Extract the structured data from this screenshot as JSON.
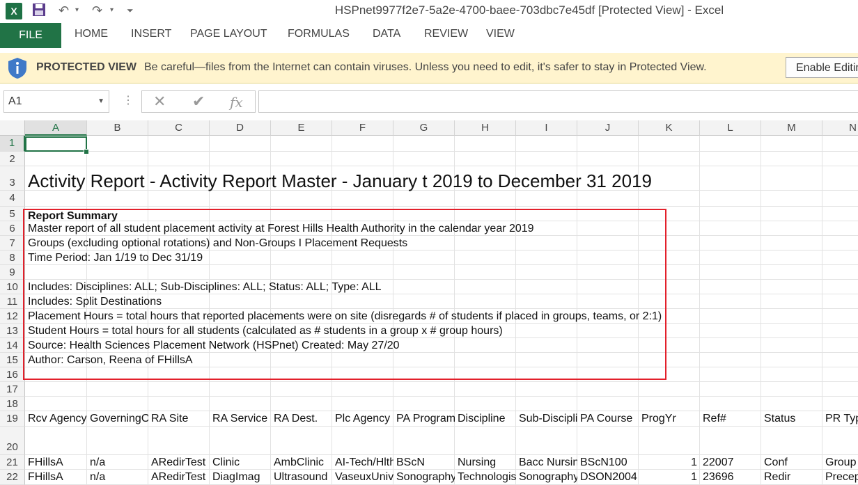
{
  "window": {
    "title": "HSPnet9977f2e7-5a2e-4700-baee-703dbc7e45df  [Protected View] - Excel",
    "app_logo": "X"
  },
  "ribbon": {
    "file_tab": "FILE",
    "tabs": [
      "HOME",
      "INSERT",
      "PAGE LAYOUT",
      "FORMULAS",
      "DATA",
      "REVIEW",
      "VIEW"
    ]
  },
  "protected_view": {
    "title": "PROTECTED VIEW",
    "message": "Be careful—files from the Internet can contain viruses. Unless you need to edit, it's safer to stay in Protected View.",
    "button": "Enable Editing"
  },
  "formula_bar": {
    "name_box": "A1",
    "fx_label": "fx",
    "formula": ""
  },
  "grid": {
    "columns": [
      "A",
      "B",
      "C",
      "D",
      "E",
      "F",
      "G",
      "H",
      "I",
      "J",
      "K",
      "L",
      "M",
      "N"
    ],
    "rows": [
      "1",
      "2",
      "3",
      "4",
      "5",
      "6",
      "7",
      "8",
      "9",
      "10",
      "11",
      "12",
      "13",
      "14",
      "15",
      "16",
      "17",
      "18",
      "19",
      "20",
      "21",
      "22"
    ],
    "title": "Activity Report - Activity Report Master - January t 2019 to December 31 2019",
    "summary": {
      "heading": "Report Summary",
      "lines": [
        "Master report of all student placement activity at Forest Hills Health Authority in the calendar year 2019",
        "Groups (excluding optional rotations) and Non-Groups I Placement Requests",
        "Time Period: Jan 1/19 to Dec 31/19",
        "",
        "Includes: Disciplines: ALL; Sub-Disciplines: ALL;  Status: ALL;  Type: ALL",
        "Includes: Split Destinations",
        "Placement Hours = total hours that reported placements were on site (disregards # of students if placed in groups, teams, or 2:1)",
        "Student Hours = total hours for all students (calculated as # students in a group x # group hours)",
        "Source: Health Sciences Placement Network (HSPnet)    Created: May 27/20",
        "Author: Carson, Reena of FHillsA"
      ]
    },
    "header_row": [
      "Rcv Agency",
      "GoverningO",
      "RA Site",
      "RA Service",
      "RA Dest.",
      "Plc Agency",
      "PA Program",
      "Discipline",
      "Sub-Discipli",
      "PA Course",
      "ProgYr",
      "Ref#",
      "Status",
      "PR Typ"
    ],
    "data_rows": [
      [
        "FHillsA",
        "n/a",
        "ARedirTest",
        "Clinic",
        "AmbClinic",
        "AI-Tech/Hlth",
        "BScN",
        "Nursing",
        "Bacc Nursin",
        "BScN100",
        "1",
        "22007",
        "Conf",
        "Group"
      ],
      [
        "FHillsA",
        "n/a",
        "ARedirTest",
        "DiagImag",
        "Ultrasound",
        "VaseuxUniv",
        "Sonography",
        "Technologis",
        "Sonography",
        "DSON2004",
        "1",
        "23696",
        "Redir",
        "Precep"
      ]
    ]
  }
}
